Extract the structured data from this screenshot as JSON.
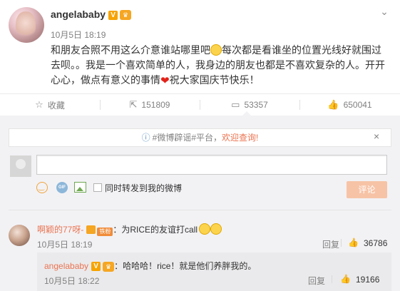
{
  "post": {
    "author": "angelababy",
    "verified_badge": "V",
    "time": "10月5日 18:19",
    "text_part1": "和朋友合照不用这么介意谁站哪里吧",
    "text_part2": "每次都是看谁坐的位置光线好就围过去呗。。我是一个喜欢简单的人，我身边的朋友也都是不喜欢复杂的人。开开心心，做点有意义的事情",
    "text_part3": "祝大家国庆节快乐！",
    "menu_icon": "chevron-down-icon"
  },
  "actions": {
    "favorite_label": "收藏",
    "repost_count": "151809",
    "comment_count": "53357",
    "like_count": "650041"
  },
  "rumor_notice": {
    "prefix": "#微博辟谣#平台，",
    "highlight": "欢迎查询!",
    "close": "×"
  },
  "composer": {
    "input_value": "",
    "gif_label": "GIF",
    "repost_label": "同时转发到我的微博",
    "submit_label": "评论"
  },
  "comments": [
    {
      "user": "啊颖的77呀-",
      "fan_badge": "铁粉",
      "colon": "：",
      "text": "为RICE的友谊打call",
      "time": "10月5日 18:19",
      "reply_label": "回复",
      "likes": "36786",
      "replies": [
        {
          "user": "angelababy",
          "verified_badge": "V",
          "colon": "：",
          "text": "哈哈哈！rice！就是他们养胖我的。",
          "time": "10月5日 18:22",
          "reply_label": "回复",
          "likes": "19166"
        }
      ]
    }
  ],
  "colors": {
    "accent_orange": "#eb7350",
    "link_blue": "#5b8ec6",
    "comment_bg": "#f2f2f5",
    "heart_red": "#e2231a"
  }
}
